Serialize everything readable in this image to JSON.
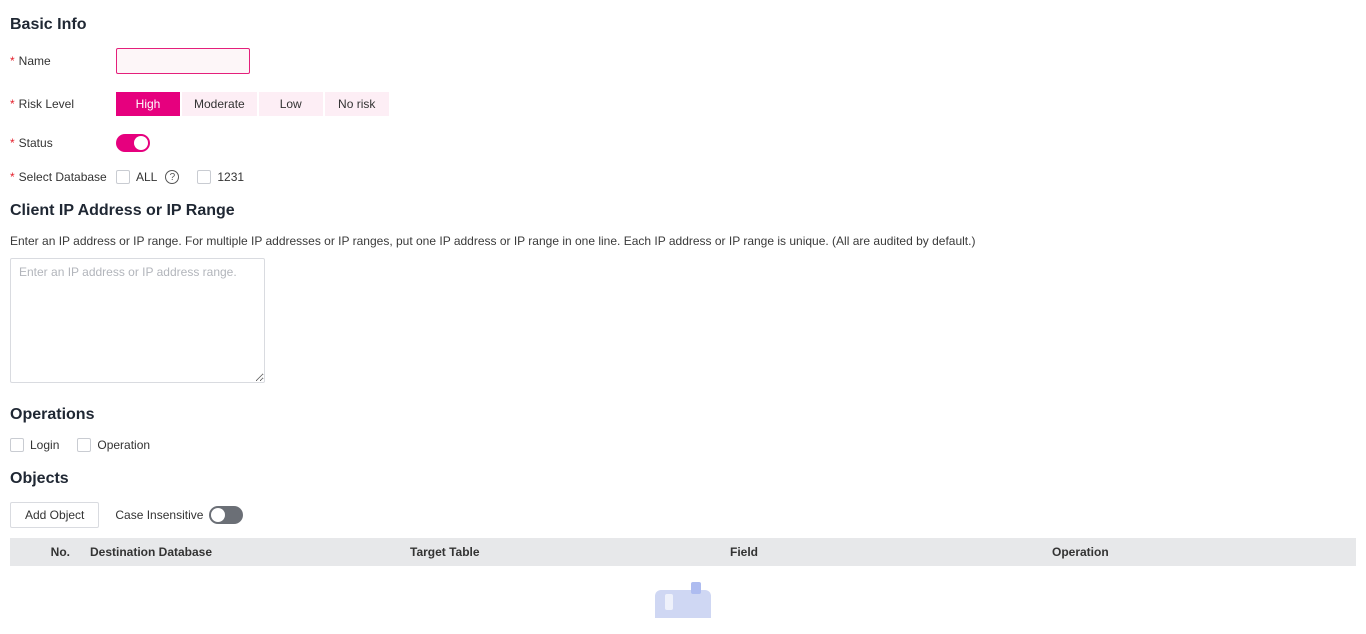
{
  "sections": {
    "basic_info": "Basic Info",
    "client_ip": "Client IP Address or IP Range",
    "operations": "Operations",
    "objects": "Objects"
  },
  "basic": {
    "name_label": "Name",
    "name_value": "",
    "risk_label": "Risk Level",
    "risk_options": {
      "high": "High",
      "moderate": "Moderate",
      "low": "Low",
      "no_risk": "No risk"
    },
    "status_label": "Status",
    "status_on": true,
    "db_label": "Select Database",
    "db_all": "ALL",
    "db_1231": "1231"
  },
  "client_ip": {
    "hint": "Enter an IP address or IP range. For multiple IP addresses or IP ranges, put one IP address or IP range in one line. Each IP address or IP range is unique. (All are audited by default.)",
    "placeholder": "Enter an IP address or IP address range.",
    "value": ""
  },
  "operations": {
    "login": "Login",
    "operation": "Operation"
  },
  "objects": {
    "add_button": "Add Object",
    "case_label": "Case Insensitive",
    "case_on": false,
    "columns": {
      "no": "No.",
      "dest": "Destination Database",
      "target": "Target Table",
      "field": "Field",
      "op": "Operation"
    }
  }
}
